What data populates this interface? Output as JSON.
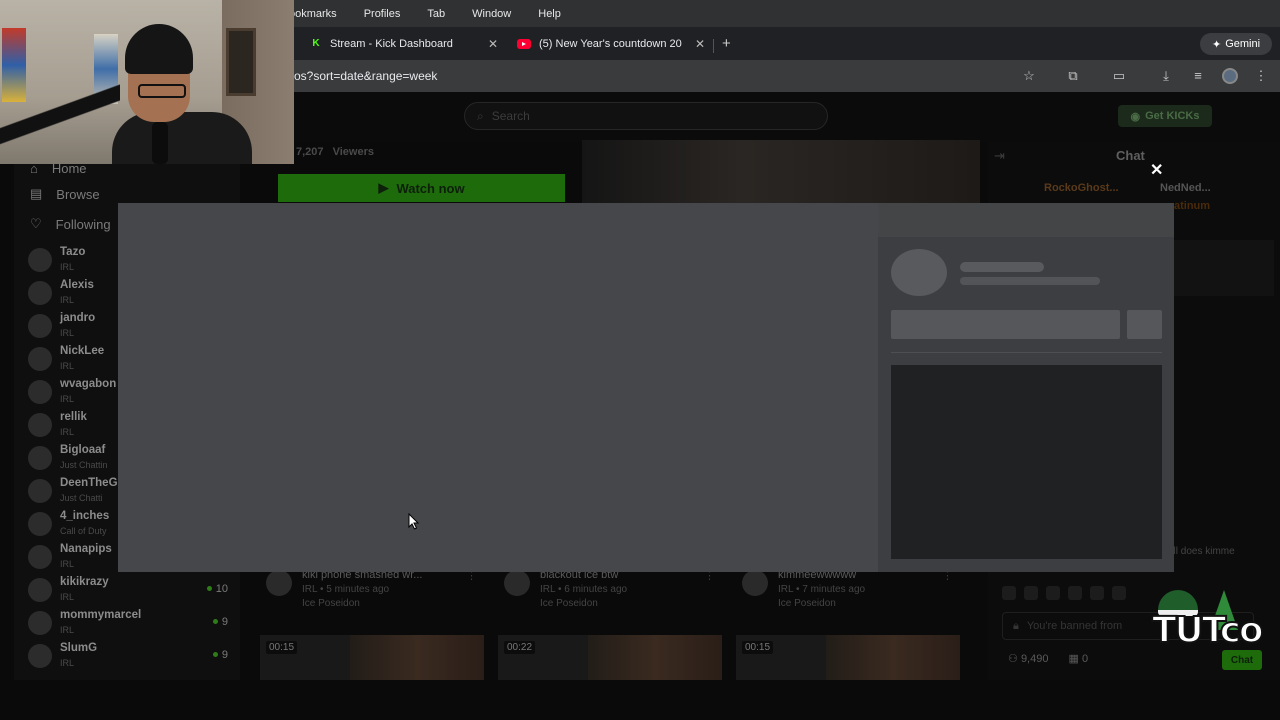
{
  "menubar": {
    "items": [
      "ookmarks",
      "Profiles",
      "Tab",
      "Window",
      "Help"
    ]
  },
  "tabs": [
    {
      "title": "Stream - Kick Dashboard",
      "icon": "kick-logo-icon"
    },
    {
      "title": "(5) New Year's countdown 20",
      "icon": "youtube-icon"
    }
  ],
  "gemini_label": "Gemini",
  "address": {
    "url": "os?sort=date&range=week"
  },
  "header": {
    "search_placeholder": "Search",
    "get_kicks_label": "Get KICKs"
  },
  "sidebar": {
    "nav": [
      {
        "label": "Home",
        "icon": "home-icon"
      },
      {
        "label": "Browse",
        "icon": "browse-icon"
      },
      {
        "label": "Following",
        "icon": "heart-icon"
      }
    ],
    "channels": [
      {
        "name": "Tazo",
        "category": "IRL",
        "viewers": ""
      },
      {
        "name": "Alexis",
        "category": "IRL",
        "viewers": ""
      },
      {
        "name": "jandro",
        "category": "IRL",
        "viewers": ""
      },
      {
        "name": "NickLee",
        "category": "IRL",
        "viewers": ""
      },
      {
        "name": "wvagabon",
        "category": "IRL",
        "viewers": ""
      },
      {
        "name": "rellik",
        "category": "IRL",
        "viewers": ""
      },
      {
        "name": "Bigloaaf",
        "category": "Just Chattin",
        "viewers": ""
      },
      {
        "name": "DeenTheG",
        "category": "Just Chatti",
        "viewers": ""
      },
      {
        "name": "4_inches",
        "category": "Call of Duty",
        "viewers": ""
      },
      {
        "name": "Nanapips",
        "category": "IRL",
        "viewers": ""
      },
      {
        "name": "kikikrazy",
        "category": "IRL",
        "viewers": "10"
      },
      {
        "name": "mommymarcel",
        "category": "IRL",
        "viewers": "9"
      },
      {
        "name": "SlumG",
        "category": "IRL",
        "viewers": "9"
      }
    ]
  },
  "hero": {
    "viewers_count": "7,207",
    "viewers_label": "Viewers",
    "watch_label": "Watch now"
  },
  "videos": [
    {
      "title": "kiki phone smashed wr...",
      "category": "IRL",
      "time": "5 minutes ago",
      "channel": "Ice Poseidon"
    },
    {
      "title": "blackout ice btw",
      "category": "IRL",
      "time": "6 minutes ago",
      "channel": "Ice Poseidon"
    },
    {
      "title": "kimmeewwwww",
      "category": "IRL",
      "time": "7 minutes ago",
      "channel": "Ice Poseidon"
    }
  ],
  "thumbs": [
    {
      "duration": "00:15"
    },
    {
      "duration": "00:22"
    },
    {
      "duration": "00:15"
    }
  ],
  "chat": {
    "title": "Chat",
    "gifter1": "RockoGhost...",
    "gifter2": "NedNed...",
    "gifter2_sub": "atinum",
    "message_fragment": "all does kimme",
    "input_placeholder": "You're banned from",
    "followers": "9,490",
    "gifts": "0",
    "send_label": "Chat"
  },
  "watermark": "TUTco",
  "colors": {
    "kick_green": "#53fc18",
    "modal_bg": "#4a4c4f"
  }
}
